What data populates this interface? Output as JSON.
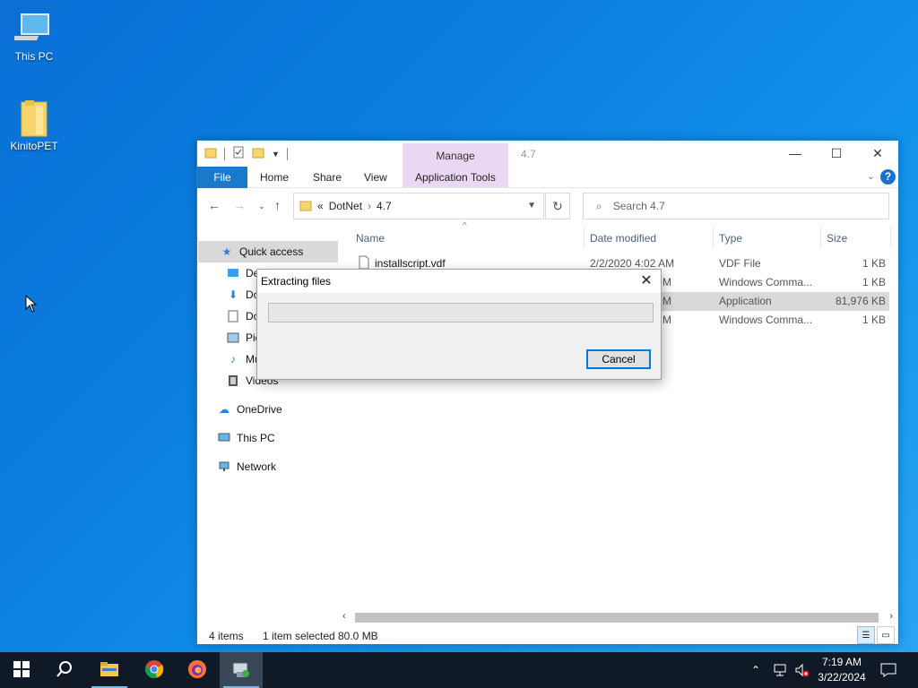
{
  "desktop": {
    "icons": [
      {
        "label": "This PC",
        "icon": "this-pc-icon"
      },
      {
        "label": "KinitoPET",
        "icon": "folder-icon"
      }
    ]
  },
  "explorer": {
    "title": "4.7",
    "contextual_tab_group": "Manage",
    "ribbon_tabs": [
      "File",
      "Home",
      "Share",
      "View",
      "Application Tools"
    ],
    "breadcrumb": {
      "overflow": "«",
      "parts": [
        "DotNet",
        "4.7"
      ]
    },
    "search_placeholder": "Search 4.7",
    "nav": [
      {
        "label": "Quick access",
        "icon": "star-icon"
      },
      {
        "label": "Desktop",
        "icon": "desktop-folder-icon",
        "visible": "De"
      },
      {
        "label": "Downloads",
        "icon": "download-icon",
        "visible": "Do"
      },
      {
        "label": "Documents",
        "icon": "documents-icon",
        "visible": "Do"
      },
      {
        "label": "Pictures",
        "icon": "pictures-icon",
        "visible": "Pic"
      },
      {
        "label": "Music",
        "icon": "music-icon",
        "visible": "Mu"
      },
      {
        "label": "Videos",
        "icon": "videos-icon",
        "visible": "Videos"
      },
      {
        "label": "OneDrive",
        "icon": "cloud-icon"
      },
      {
        "label": "This PC",
        "icon": "this-pc-icon"
      },
      {
        "label": "Network",
        "icon": "network-icon"
      }
    ],
    "columns": [
      "Name",
      "Date modified",
      "Type",
      "Size"
    ],
    "files": [
      {
        "name": "installscript.vdf",
        "date": "2/2/2020 4:02 AM",
        "type": "VDF File",
        "size": "1 KB",
        "selected": false
      },
      {
        "name": "",
        "date": "M",
        "type": "Windows Comma...",
        "size": "1 KB",
        "selected": false
      },
      {
        "name": "",
        "date": "M",
        "type": "Application",
        "size": "81,976 KB",
        "selected": true
      },
      {
        "name": "",
        "date": "M",
        "type": "Windows Comma...",
        "size": "1 KB",
        "selected": false
      }
    ],
    "status": {
      "count": "4 items",
      "selected": "1 item selected",
      "size": "80.0 MB"
    }
  },
  "dialog": {
    "title": "Extracting files",
    "progress": 0.0,
    "cancel_label": "Cancel"
  },
  "taskbar": {
    "apps": [
      "start-icon",
      "search-icon",
      "file-explorer-icon",
      "chrome-icon",
      "firefox-icon",
      "installer-icon"
    ],
    "time": "7:19 AM",
    "date": "3/22/2024"
  }
}
